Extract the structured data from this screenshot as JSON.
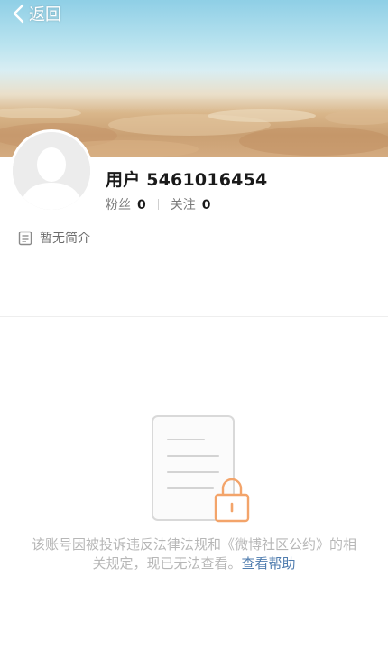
{
  "nav": {
    "back_label": "返回"
  },
  "profile": {
    "username": "用户 5461016454",
    "fans_label": "粉丝",
    "fans_count": "0",
    "following_label": "关注",
    "following_count": "0",
    "bio": "暂无简介"
  },
  "notice": {
    "text": "该账号因被投诉违反法律法规和《微博社区公约》的相关规定，现已无法查看。",
    "help_link": "查看帮助"
  },
  "colors": {
    "link": "#507daf",
    "notice_text": "#b7b7b7",
    "lock_orange": "#f3a46a"
  },
  "icons": [
    "chevron-left-icon",
    "default-avatar-icon",
    "document-icon",
    "locked-document-icon"
  ]
}
